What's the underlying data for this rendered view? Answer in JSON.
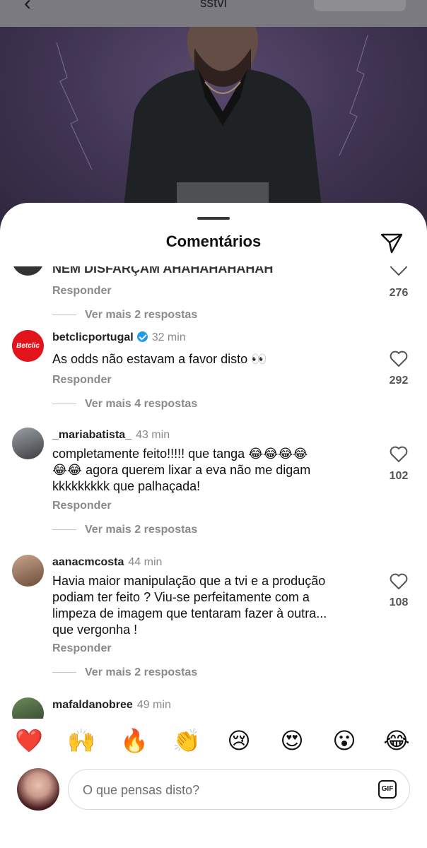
{
  "header": {
    "back_icon": "back-arrow-icon",
    "username": "sstvi",
    "follow_label": ""
  },
  "sheet": {
    "title": "Comentários",
    "share_icon": "send-icon"
  },
  "partial_comment": {
    "text": "NEM DISFARÇAM AHAHAHAHAHAH",
    "reply_label": "Responder",
    "likes": "276",
    "more_label": "Ver mais 2 respostas"
  },
  "comments": [
    {
      "username": "betclicportugal",
      "verified": true,
      "time": "32 min",
      "text": "As odds não estavam a favor disto 👀",
      "reply_label": "Responder",
      "likes": "292",
      "more_label": "Ver mais 4 respostas",
      "avatar_label": "Betclic"
    },
    {
      "username": "_mariabatista_",
      "verified": false,
      "time": "43 min",
      "text": "completamente feito!!!!! que tanga 😂😂😂😂\n😂😂 agora querem lixar a eva não me digam\nkkkkkkkkk que palhaçada!",
      "reply_label": "Responder",
      "likes": "102",
      "more_label": "Ver mais 2 respostas"
    },
    {
      "username": "aanacmcosta",
      "verified": false,
      "time": "44 min",
      "text": "Havia maior manipulação que a tvi e a produção\npodiam ter feito ? Viu-se perfeitamente com a\nlimpeza de imagem que tentaram fazer à outra...\nque vergonha !",
      "reply_label": "Responder",
      "likes": "108",
      "more_label": "Ver mais 2 respostas"
    },
    {
      "username": "mafaldanobree",
      "verified": false,
      "time": "49 min"
    }
  ],
  "emoji_bar": [
    "❤️",
    "🙌",
    "🔥",
    "👏",
    "😢",
    "😍",
    "😮",
    "😂"
  ],
  "composer": {
    "placeholder": "O que pensas disto?",
    "gif_label": "GIF"
  },
  "colors": {
    "verified": "#1d9bf0",
    "secondary_text": "#8a8a8a",
    "betclic_red": "#e3131b"
  }
}
